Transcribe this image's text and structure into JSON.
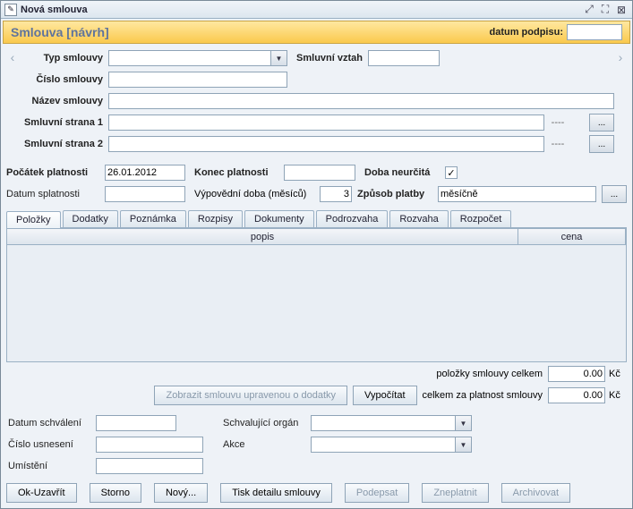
{
  "window": {
    "title": "Nová smlouva"
  },
  "header": {
    "title": "Smlouva [návrh]",
    "date_label": "datum podpisu:",
    "date_value": ""
  },
  "form": {
    "typ_smlouvy_label": "Typ smlouvy",
    "typ_smlouvy_value": "",
    "smluvni_vztah_label": "Smluvní vztah",
    "smluvni_vztah_value": "",
    "cislo_smlouvy_label": "Číslo smlouvy",
    "cislo_smlouvy_value": "",
    "nazev_smlouvy_label": "Název smlouvy",
    "nazev_smlouvy_value": "",
    "strana1_label": "Smluvní strana 1",
    "strana1_value": "",
    "strana1_dash": "----",
    "strana2_label": "Smluvní strana 2",
    "strana2_value": "",
    "strana2_dash": "----",
    "pocatek_label": "Počátek platnosti",
    "pocatek_value": "26.01.2012",
    "konec_label": "Konec platnosti",
    "konec_value": "",
    "neurc_label": "Doba neurčitá",
    "neurc_checked": "✓",
    "splatnost_label": "Datum splatnosti",
    "splatnost_value": "",
    "vypovedni_label": "Výpovědní doba (měsíců)",
    "vypovedni_value": "3",
    "zpusob_label": "Způsob platby",
    "zpusob_value": "měsíčně"
  },
  "tabs": [
    "Položky",
    "Dodatky",
    "Poznámka",
    "Rozpisy",
    "Dokumenty",
    "Podrozvaha",
    "Rozvaha",
    "Rozpočet"
  ],
  "grid": {
    "col_popis": "popis",
    "col_cena": "cena"
  },
  "totals": {
    "items_label": "položky smlouvy celkem",
    "items_value": "0.00",
    "unit": "Kč",
    "show_btn": "Zobrazit smlouvu upravenou o dodatky",
    "calc_btn": "Vypočítat",
    "period_label": "celkem za platnost smlouvy",
    "period_value": "0.00"
  },
  "approval": {
    "datum_label": "Datum schválení",
    "datum_value": "",
    "organ_label": "Schvalující orgán",
    "organ_value": "",
    "usneseni_label": "Číslo usnesení",
    "usneseni_value": "",
    "akce_label": "Akce",
    "akce_value": "",
    "umisteni_label": "Umístění",
    "umisteni_value": ""
  },
  "buttons": {
    "ok": "Ok-Uzavřít",
    "storno": "Storno",
    "novy": "Nový...",
    "tisk": "Tisk detailu smlouvy",
    "podepsat": "Podepsat",
    "zneplatnit": "Zneplatnit",
    "archivovat": "Archivovat"
  }
}
